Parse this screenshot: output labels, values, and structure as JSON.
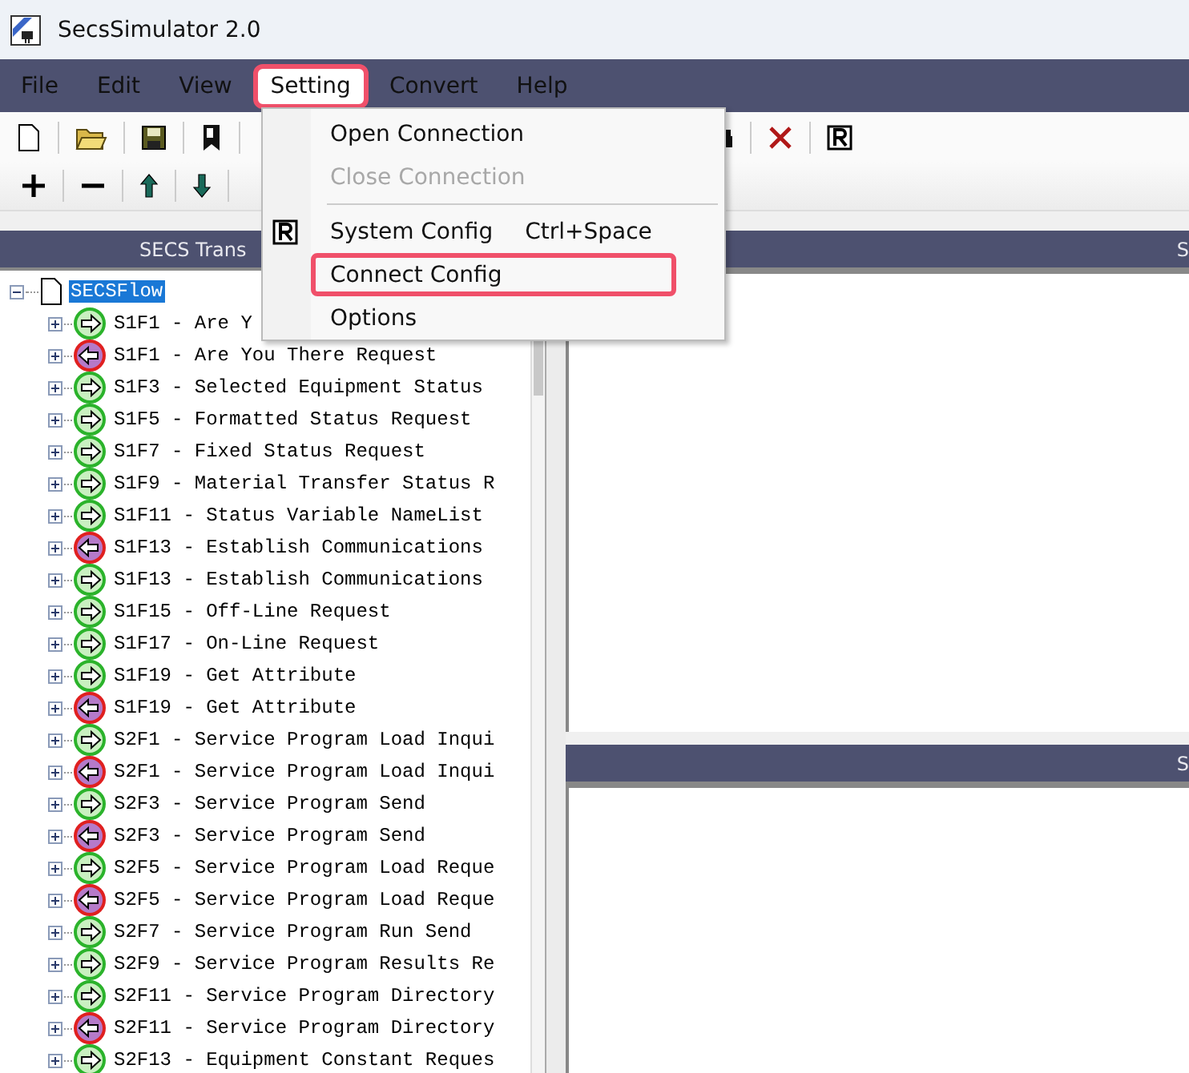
{
  "window": {
    "title": "SecsSimulator 2.0"
  },
  "menu_bar": [
    {
      "label": "File",
      "selected": false,
      "highlighted": false
    },
    {
      "label": "Edit",
      "selected": false,
      "highlighted": false
    },
    {
      "label": "View",
      "selected": false,
      "highlighted": false
    },
    {
      "label": "Setting",
      "selected": true,
      "highlighted": true
    },
    {
      "label": "Convert",
      "selected": false,
      "highlighted": false
    },
    {
      "label": "Help",
      "selected": false,
      "highlighted": false
    }
  ],
  "setting_menu": {
    "items": [
      {
        "kind": "item",
        "label": "Open Connection",
        "disabled": false,
        "highlighted": false
      },
      {
        "kind": "item",
        "label": "Close Connection",
        "disabled": true,
        "highlighted": false
      },
      {
        "kind": "separator"
      },
      {
        "kind": "item",
        "label": "System Config",
        "shortcut": "Ctrl+Space",
        "icon": true,
        "disabled": false,
        "highlighted": false
      },
      {
        "kind": "item",
        "label": "Connect Config",
        "disabled": false,
        "highlighted": true
      },
      {
        "kind": "item",
        "label": "Options",
        "disabled": false,
        "highlighted": false
      }
    ]
  },
  "panels": {
    "left_header": "SECS Trans",
    "right_top_header": "S",
    "right_bottom_header": "S"
  },
  "tree": {
    "label": "SECSFlow",
    "selected": true,
    "expanded": true,
    "children": [
      {
        "label": "S1F1 - Are Y",
        "kind": "send",
        "expanded": false
      },
      {
        "label": "S1F1 - Are You There Request",
        "kind": "reply",
        "expanded": false
      },
      {
        "label": "S1F3 - Selected Equipment Status",
        "kind": "send",
        "expanded": false
      },
      {
        "label": "S1F5 - Formatted Status Request",
        "kind": "send",
        "expanded": false
      },
      {
        "label": "S1F7 - Fixed Status Request",
        "kind": "send",
        "expanded": false
      },
      {
        "label": "S1F9 - Material Transfer Status R",
        "kind": "send",
        "expanded": false
      },
      {
        "label": "S1F11 - Status Variable NameList",
        "kind": "send",
        "expanded": false
      },
      {
        "label": "S1F13 - Establish Communications",
        "kind": "reply",
        "expanded": false
      },
      {
        "label": "S1F13 - Establish Communications",
        "kind": "send",
        "expanded": false
      },
      {
        "label": "S1F15 - Off-Line Request",
        "kind": "send",
        "expanded": false
      },
      {
        "label": "S1F17 - On-Line Request",
        "kind": "send",
        "expanded": false
      },
      {
        "label": "S1F19 - Get Attribute",
        "kind": "send",
        "expanded": false
      },
      {
        "label": "S1F19 - Get Attribute",
        "kind": "reply",
        "expanded": false
      },
      {
        "label": "S2F1 - Service Program Load Inqui",
        "kind": "send",
        "expanded": false
      },
      {
        "label": "S2F1 - Service Program Load Inqui",
        "kind": "reply",
        "expanded": false
      },
      {
        "label": "S2F3 - Service Program Send",
        "kind": "send",
        "expanded": false
      },
      {
        "label": "S2F3 - Service Program Send",
        "kind": "reply",
        "expanded": false
      },
      {
        "label": "S2F5 - Service Program Load Reque",
        "kind": "send",
        "expanded": false
      },
      {
        "label": "S2F5 - Service Program Load Reque",
        "kind": "reply",
        "expanded": false
      },
      {
        "label": "S2F7 - Service Program Run Send",
        "kind": "send",
        "expanded": false
      },
      {
        "label": "S2F9 - Service Program Results Re",
        "kind": "send",
        "expanded": false
      },
      {
        "label": "S2F11 - Service Program Directory",
        "kind": "send",
        "expanded": false
      },
      {
        "label": "S2F11 - Service Program Directory",
        "kind": "reply",
        "expanded": false
      },
      {
        "label": "S2F13 - Equipment Constant Reques",
        "kind": "send",
        "expanded": false
      }
    ]
  }
}
